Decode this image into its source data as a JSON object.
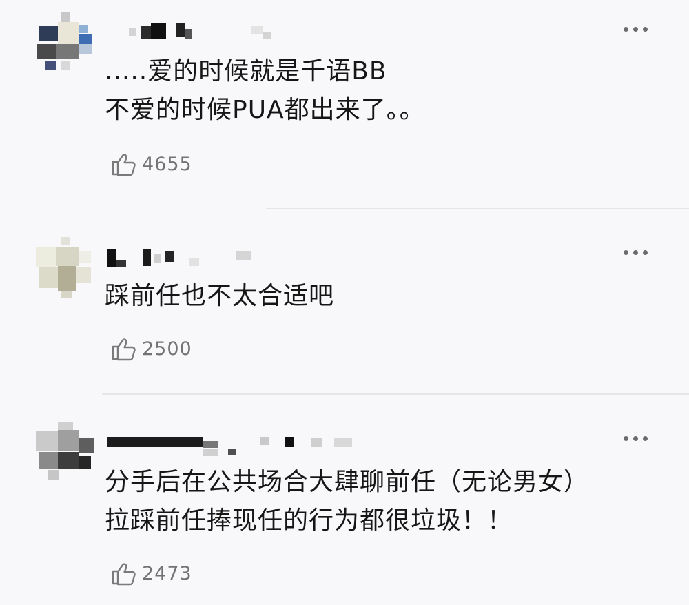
{
  "comments": [
    {
      "lines": [
        ".....爱的时候就是千语BB",
        "不爱的时候PUA都出来了。。"
      ],
      "likes": "4655",
      "like_icon": "thumbs-up-icon",
      "more_icon": "more-horizontal-icon"
    },
    {
      "lines": [
        "踩前任也不太合适吧"
      ],
      "likes": "2500",
      "like_icon": "thumbs-up-icon",
      "more_icon": "more-horizontal-icon"
    },
    {
      "lines": [
        "分手后在公共场合大肆聊前任（无论男女）",
        "拉踩前任捧现任的行为都很垃圾！！"
      ],
      "likes": "2473",
      "like_icon": "thumbs-up-icon",
      "more_icon": "more-horizontal-icon"
    }
  ]
}
